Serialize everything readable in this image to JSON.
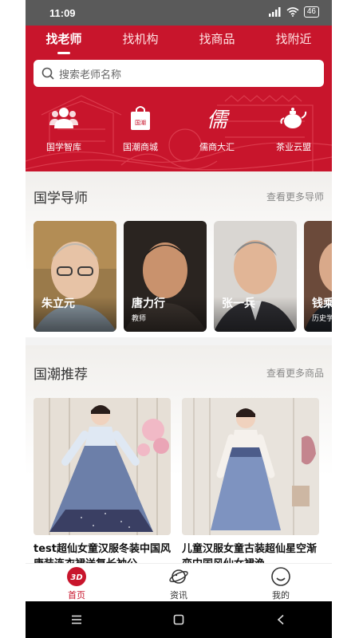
{
  "status_bar": {
    "time": "11:09",
    "battery": "46"
  },
  "tabs": [
    {
      "label": "找老师",
      "active": true
    },
    {
      "label": "找机构",
      "active": false
    },
    {
      "label": "找商品",
      "active": false
    },
    {
      "label": "找附近",
      "active": false
    }
  ],
  "search": {
    "placeholder": "搜索老师名称"
  },
  "quick_links": [
    {
      "label": "国学智库",
      "icon": "people-icon"
    },
    {
      "label": "国潮商城",
      "icon": "shopping-bag-icon",
      "badge": "国潮"
    },
    {
      "label": "儒商大汇",
      "icon": "calligraphy-ru-icon",
      "glyph": "儒"
    },
    {
      "label": "茶业云盟",
      "icon": "teapot-icon"
    }
  ],
  "mentors": {
    "title": "国学导师",
    "more": "查看更多导师",
    "items": [
      {
        "name": "朱立元",
        "role": ""
      },
      {
        "name": "唐力行",
        "role": "教师"
      },
      {
        "name": "张一兵",
        "role": ""
      },
      {
        "name": "钱乘",
        "role": "历史学"
      }
    ]
  },
  "products": {
    "title": "国潮推荐",
    "more": "查看更多商品",
    "items": [
      {
        "title": "test超仙女童汉服冬装中国风唐装连衣裙送复长袖公"
      },
      {
        "title": "儿童汉服女童古装超仙星空渐变中国风仙女裙渔"
      }
    ]
  },
  "bottom_nav": [
    {
      "label": "首页",
      "icon": "home-logo-icon",
      "active": true
    },
    {
      "label": "资讯",
      "icon": "planet-icon",
      "active": false
    },
    {
      "label": "我的",
      "icon": "smiley-icon",
      "active": false
    }
  ],
  "colors": {
    "brand_red": "#c8152c",
    "status_bar": "#5a5a5a",
    "system_nav": "#000000"
  }
}
